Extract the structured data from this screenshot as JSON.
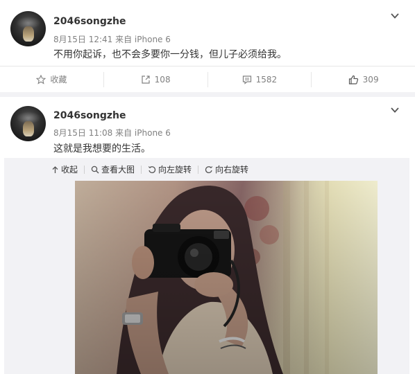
{
  "posts": [
    {
      "username": "2046songzhe",
      "meta": "8月15日 12:41 来自 iPhone 6",
      "content": "不用你起诉，也不会多要你一分钱，但儿子必须给我。",
      "actions": {
        "favorite_label": "收藏",
        "repost_count": "108",
        "comment_count": "1582",
        "like_count": "309"
      }
    },
    {
      "username": "2046songzhe",
      "meta": "8月15日 11:08 来自 iPhone 6",
      "content": "这就是我想要的生活。",
      "media_toolbar": {
        "collapse": "收起",
        "view_large": "查看大图",
        "rotate_left": "向左旋转",
        "rotate_right": "向右旋转"
      }
    }
  ],
  "icons": {
    "favorite": "star-outline-icon",
    "repost": "share-arrow-icon",
    "comment": "comment-bubble-icon",
    "like": "thumbs-up-icon",
    "more": "chevron-down-icon"
  },
  "colors": {
    "text_primary": "#333333",
    "text_meta": "#808080",
    "divider": "#e6e6e6",
    "media_bg": "#f2f2f5"
  }
}
